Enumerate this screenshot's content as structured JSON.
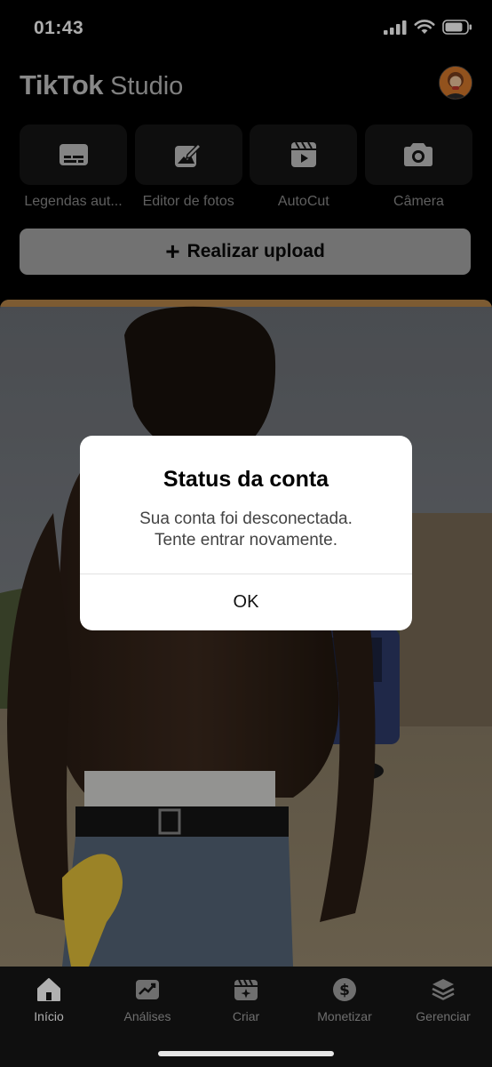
{
  "status_bar": {
    "time": "01:43"
  },
  "header": {
    "logo_main": "TikTok",
    "logo_sub": "Studio"
  },
  "tools": [
    {
      "label": "Legendas aut...",
      "icon": "captions-icon"
    },
    {
      "label": "Editor de fotos",
      "icon": "photo-editor-icon"
    },
    {
      "label": "AutoCut",
      "icon": "autocut-icon"
    },
    {
      "label": "Câmera",
      "icon": "camera-icon"
    }
  ],
  "upload": {
    "plus": "+",
    "label": "Realizar upload"
  },
  "dialog": {
    "title": "Status da conta",
    "message_line1": "Sua conta foi desconectada.",
    "message_line2": "Tente entrar novamente.",
    "ok_label": "OK"
  },
  "tabbar": {
    "items": [
      {
        "label": "Início",
        "icon": "home-icon",
        "active": true
      },
      {
        "label": "Análises",
        "icon": "analytics-icon",
        "active": false
      },
      {
        "label": "Criar",
        "icon": "create-icon",
        "active": false
      },
      {
        "label": "Monetizar",
        "icon": "dollar-icon",
        "active": false
      },
      {
        "label": "Gerenciar",
        "icon": "layers-icon",
        "active": false
      }
    ]
  },
  "colors": {
    "dialog_bg": "#ffffff",
    "page_bg": "#000000",
    "upload_bg": "#a9a9a9"
  }
}
